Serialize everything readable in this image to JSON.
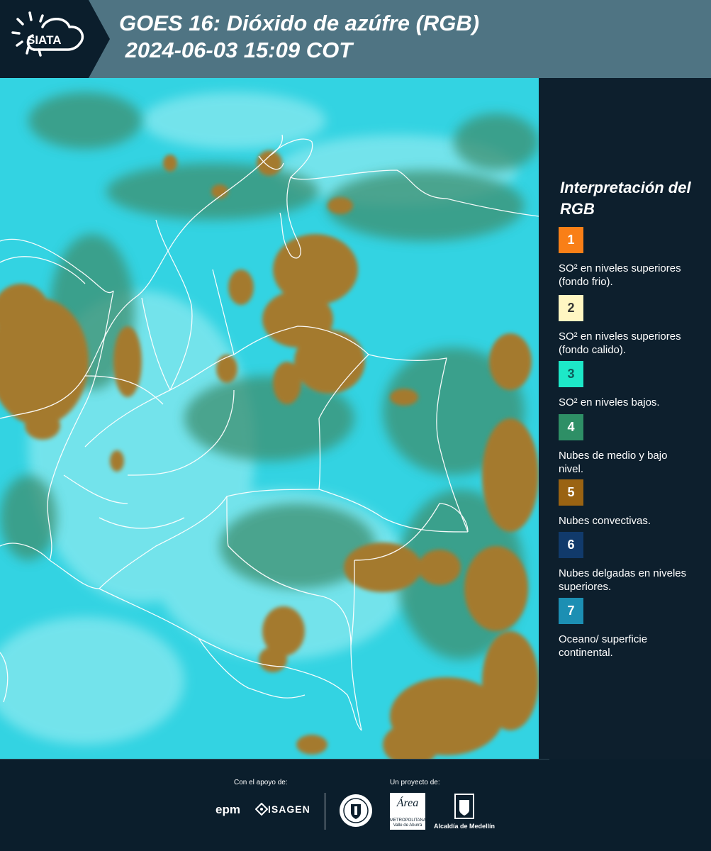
{
  "header": {
    "logo_text": "SIATA",
    "title": "GOES 16: Dióxido de azúfre (RGB)\n 2024-06-03 15:09 COT"
  },
  "map": {
    "background_color": "#33d3e2",
    "cloud_color": "#a47a2e",
    "mid_cloud_color": "#3d8f6f",
    "border_color": "#ffffff"
  },
  "legend": {
    "title": "Interpretación del RGB",
    "items": [
      {
        "number": "1",
        "color": "#f97f17",
        "description": "SO² en niveles superiores (fondo frio)."
      },
      {
        "number": "2",
        "color": "#fff6c2",
        "description": "SO² en niveles superiores (fondo calido)."
      },
      {
        "number": "3",
        "color": "#1de8c8",
        "description": "SO² en niveles bajos."
      },
      {
        "number": "4",
        "color": "#2e8f66",
        "description": "Nubes de medio y bajo nivel."
      },
      {
        "number": "5",
        "color": "#9a6312",
        "description": "Nubes convectivas."
      },
      {
        "number": "6",
        "color": "#113a6b",
        "description": "Nubes delgadas en niveles superiores."
      },
      {
        "number": "7",
        "color": "#1c8fb3",
        "description": "Oceano/ superficie continental."
      }
    ]
  },
  "footer": {
    "support_label": "Con el apoyo de:",
    "project_label": "Un proyecto de:",
    "epm_text": "epm",
    "isagen_text": "ISAGEN",
    "area_text": "Área",
    "area_sub": "METROPOLITANA Valle de Aburrá",
    "alcaldia_text": "Alcaldía de Medellín"
  }
}
